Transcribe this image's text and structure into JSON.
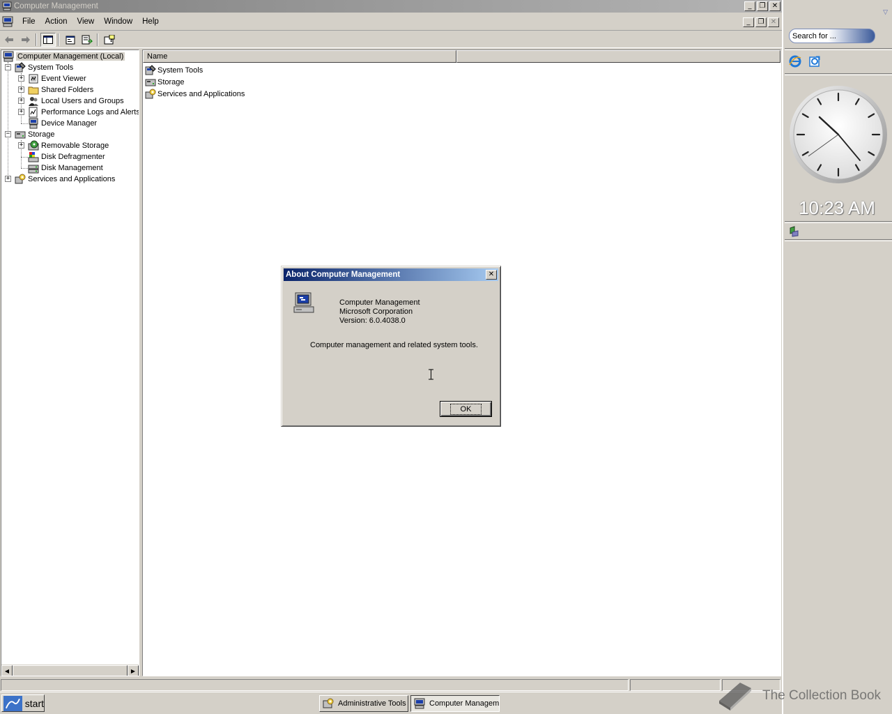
{
  "window": {
    "title": "Computer Management"
  },
  "menubar": {
    "items": [
      {
        "label": "File"
      },
      {
        "label": "Action"
      },
      {
        "label": "View"
      },
      {
        "label": "Window"
      },
      {
        "label": "Help"
      }
    ]
  },
  "tree": {
    "root": "Computer Management (Local)",
    "items": [
      {
        "label": "System Tools",
        "level": 1,
        "expander": "−"
      },
      {
        "label": "Event Viewer",
        "level": 2,
        "expander": "+"
      },
      {
        "label": "Shared Folders",
        "level": 2,
        "expander": "+"
      },
      {
        "label": "Local Users and Groups",
        "level": 2,
        "expander": "+"
      },
      {
        "label": "Performance Logs and Alerts",
        "level": 2,
        "expander": "+"
      },
      {
        "label": "Device Manager",
        "level": 2,
        "expander": ""
      },
      {
        "label": "Storage",
        "level": 1,
        "expander": "−"
      },
      {
        "label": "Removable Storage",
        "level": 2,
        "expander": "+"
      },
      {
        "label": "Disk Defragmenter",
        "level": 2,
        "expander": ""
      },
      {
        "label": "Disk Management",
        "level": 2,
        "expander": ""
      },
      {
        "label": "Services and Applications",
        "level": 1,
        "expander": "+"
      }
    ]
  },
  "list": {
    "column_name": "Name",
    "rows": [
      {
        "label": "System Tools"
      },
      {
        "label": "Storage"
      },
      {
        "label": "Services and Applications"
      }
    ]
  },
  "dialog": {
    "title": "About Computer Management",
    "product": "Computer Management",
    "company": "Microsoft Corporation",
    "version": "Version: 6.0.4038.0",
    "description": "Computer management and related system tools.",
    "ok_label": "OK"
  },
  "sidebar": {
    "search_placeholder": "Search for ...",
    "clock_time": "10:23 AM"
  },
  "taskbar": {
    "start_label": "start",
    "buttons": [
      {
        "label": "Administrative Tools"
      },
      {
        "label": "Computer Management"
      }
    ]
  },
  "watermark": {
    "text": "The Collection Book"
  },
  "colors": {
    "title_active": "#0a246a",
    "title_inactive": "#808080",
    "face": "#d4d0c8"
  }
}
